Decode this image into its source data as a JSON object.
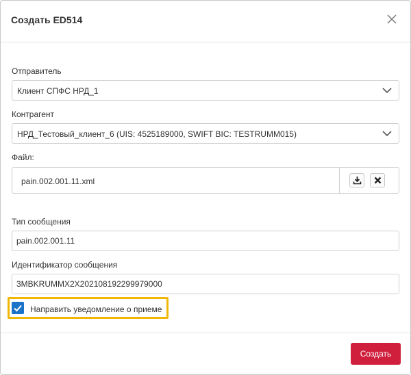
{
  "dialog": {
    "title": "Создать ED514",
    "close_icon": "close-icon"
  },
  "form": {
    "sender": {
      "label": "Отправитель",
      "value": "Клиент СПФС НРД_1",
      "icon": "chevron-down-icon"
    },
    "counterparty": {
      "label": "Контрагент",
      "value": "НРД_Тестовый_клиент_6 (UIS: 4525189000, SWIFT BIC: TESTRUMM015)",
      "icon": "chevron-down-icon"
    },
    "file": {
      "label": "Файл:",
      "name": "pain.002.001.11.xml",
      "download_icon": "download-icon",
      "remove_icon": "close-icon"
    },
    "message_type": {
      "label": "Тип сообщения",
      "value": "pain.002.001.11"
    },
    "message_id": {
      "label": "Идентификатор сообщения",
      "value": "3MBKRUMMX2X202108192299979000"
    },
    "notify": {
      "label": "Направить уведомление о приеме",
      "checked": true
    }
  },
  "footer": {
    "create_label": "Создать"
  },
  "colors": {
    "primary": "#d01f3c",
    "checkbox": "#1a73c9",
    "highlight": "#f2b705"
  }
}
